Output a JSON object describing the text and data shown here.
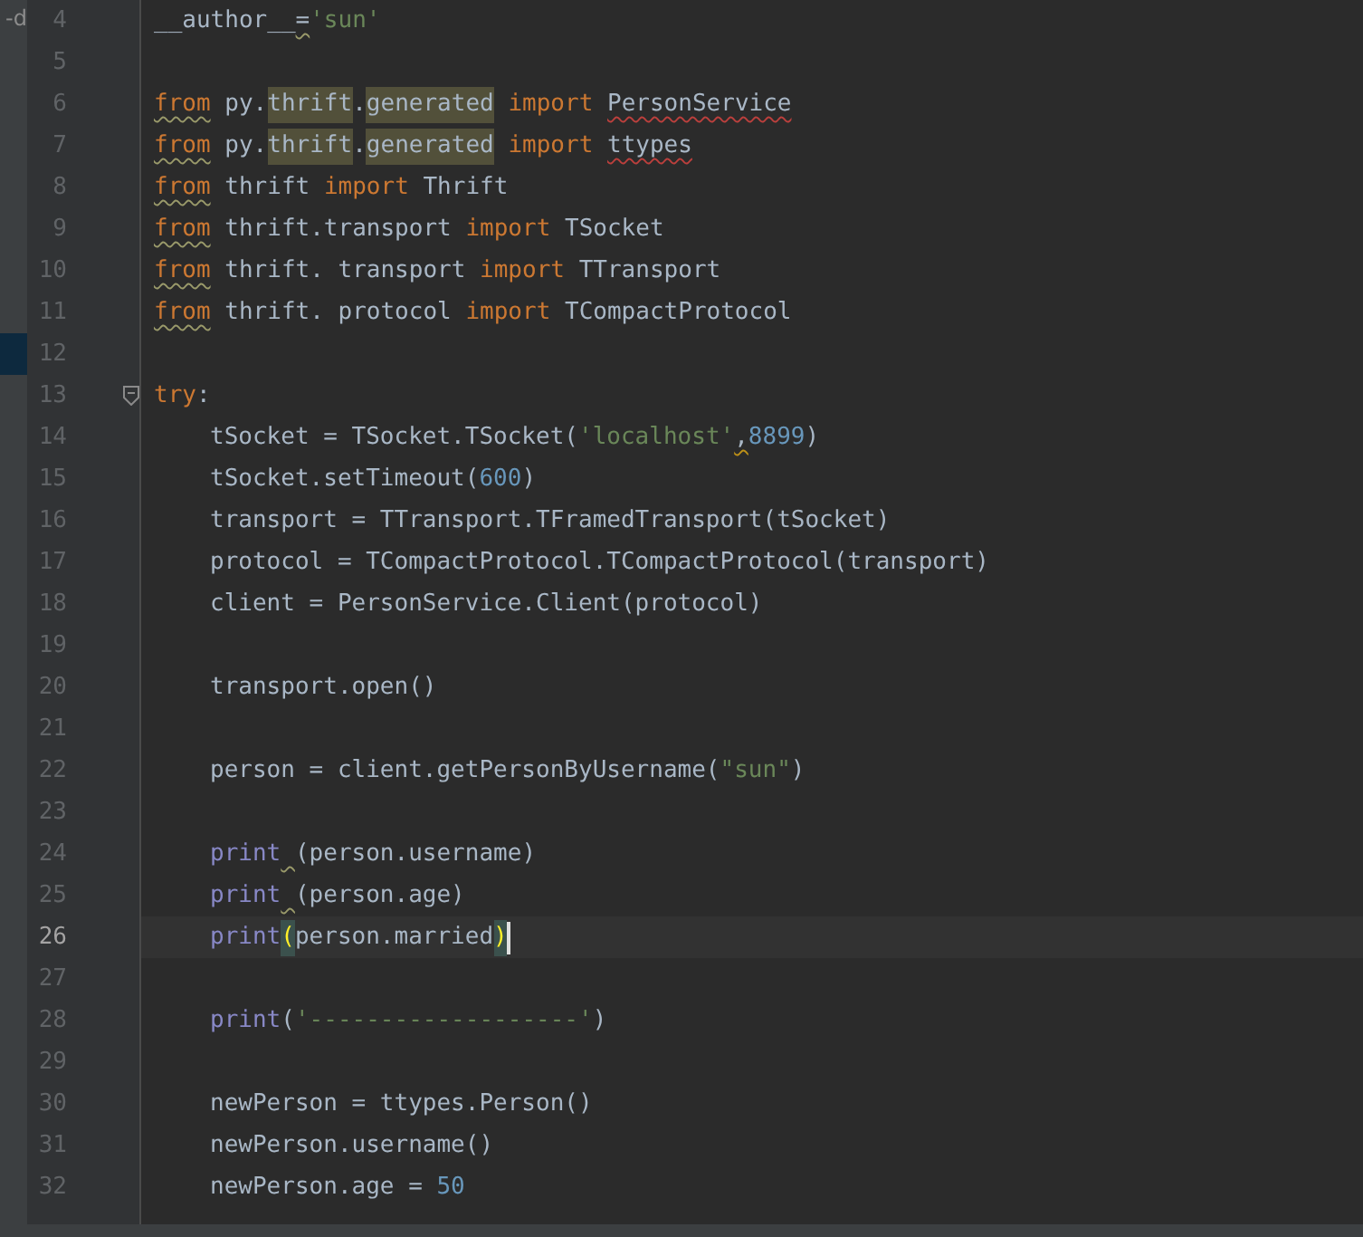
{
  "side_strip": {
    "text": "-d"
  },
  "editor": {
    "lines": [
      {
        "number": "4",
        "current": false,
        "marked": false,
        "fold": false,
        "indented": false,
        "tokens": [
          {
            "text": "__author__",
            "kind": "plain"
          },
          {
            "text": "=",
            "kind": "plain_weak"
          },
          {
            "text": "'sun'",
            "kind": "string"
          }
        ]
      },
      {
        "number": "5",
        "current": false,
        "marked": false,
        "fold": false
      },
      {
        "number": "6",
        "current": false,
        "marked": false,
        "fold": false,
        "indented": false,
        "tokens": [
          {
            "text": "from",
            "kind": "keyword_weak"
          },
          {
            "text": " py.",
            "kind": "plain"
          },
          {
            "text": "thrift",
            "kind": "usage"
          },
          {
            "text": ".",
            "kind": "plain"
          },
          {
            "text": "generated",
            "kind": "usage"
          },
          {
            "text": " import ",
            "kind": "keyword"
          },
          {
            "text": "PersonService",
            "kind": "plain_error"
          }
        ]
      },
      {
        "number": "7",
        "current": false,
        "marked": false,
        "fold": false,
        "indented": false,
        "tokens": [
          {
            "text": "from",
            "kind": "keyword_weak"
          },
          {
            "text": " py.",
            "kind": "plain"
          },
          {
            "text": "thrift",
            "kind": "usage"
          },
          {
            "text": ".",
            "kind": "plain"
          },
          {
            "text": "generated",
            "kind": "usage"
          },
          {
            "text": " import ",
            "kind": "keyword"
          },
          {
            "text": "ttypes",
            "kind": "plain_error"
          }
        ]
      },
      {
        "number": "8",
        "current": false,
        "marked": false,
        "fold": false,
        "indented": false,
        "tokens": [
          {
            "text": "from",
            "kind": "keyword_weak"
          },
          {
            "text": " thrift ",
            "kind": "plain"
          },
          {
            "text": "import",
            "kind": "keyword"
          },
          {
            "text": " Thrift",
            "kind": "plain"
          }
        ]
      },
      {
        "number": "9",
        "current": false,
        "marked": false,
        "fold": false,
        "indented": false,
        "tokens": [
          {
            "text": "from",
            "kind": "keyword_weak"
          },
          {
            "text": " thrift.transport ",
            "kind": "plain"
          },
          {
            "text": "import",
            "kind": "keyword"
          },
          {
            "text": " TSocket",
            "kind": "plain"
          }
        ]
      },
      {
        "number": "10",
        "current": false,
        "marked": false,
        "fold": false,
        "indented": false,
        "tokens": [
          {
            "text": "from",
            "kind": "keyword_weak"
          },
          {
            "text": " thrift. transport ",
            "kind": "plain"
          },
          {
            "text": "import",
            "kind": "keyword"
          },
          {
            "text": " TTransport",
            "kind": "plain"
          }
        ]
      },
      {
        "number": "11",
        "current": false,
        "marked": false,
        "fold": false,
        "indented": false,
        "tokens": [
          {
            "text": "from",
            "kind": "keyword_weak"
          },
          {
            "text": " thrift. protocol ",
            "kind": "plain"
          },
          {
            "text": "import",
            "kind": "keyword"
          },
          {
            "text": " TCompactProtocol",
            "kind": "plain"
          }
        ]
      },
      {
        "number": "12",
        "current": false,
        "marked": true,
        "fold": false
      },
      {
        "number": "13",
        "current": false,
        "marked": false,
        "fold": true,
        "indented": false,
        "tokens": [
          {
            "text": "try",
            "kind": "keyword"
          },
          {
            "text": ":",
            "kind": "plain"
          }
        ]
      },
      {
        "number": "14",
        "current": false,
        "marked": false,
        "fold": false,
        "indented": true,
        "tokens": [
          {
            "text": "tSocket = TSocket.TSocket(",
            "kind": "plain"
          },
          {
            "text": "'localhost'",
            "kind": "string"
          },
          {
            "text": ",8899",
            "kind": "number_leadwarn"
          },
          {
            "text": ")",
            "kind": "plain"
          }
        ]
      },
      {
        "number": "15",
        "current": false,
        "marked": false,
        "fold": false,
        "indented": true,
        "tokens": [
          {
            "text": "tSocket.setTimeout(",
            "kind": "plain"
          },
          {
            "text": "600",
            "kind": "number"
          },
          {
            "text": ")",
            "kind": "plain"
          }
        ]
      },
      {
        "number": "16",
        "current": false,
        "marked": false,
        "fold": false,
        "indented": true,
        "tokens": [
          {
            "text": "transport = TTransport.TFramedTransport(tSocket)",
            "kind": "plain"
          }
        ]
      },
      {
        "number": "17",
        "current": false,
        "marked": false,
        "fold": false,
        "indented": true,
        "tokens": [
          {
            "text": "protocol = TCompactProtocol.TCompactProtocol(transport)",
            "kind": "plain"
          }
        ]
      },
      {
        "number": "18",
        "current": false,
        "marked": false,
        "fold": false,
        "indented": true,
        "tokens": [
          {
            "text": "client = PersonService.Client(protocol)",
            "kind": "plain"
          }
        ]
      },
      {
        "number": "19",
        "current": false,
        "marked": false,
        "fold": false
      },
      {
        "number": "20",
        "current": false,
        "marked": false,
        "fold": false,
        "indented": true,
        "tokens": [
          {
            "text": "transport.open()",
            "kind": "plain"
          }
        ]
      },
      {
        "number": "21",
        "current": false,
        "marked": false,
        "fold": false
      },
      {
        "number": "22",
        "current": false,
        "marked": false,
        "fold": false,
        "indented": true,
        "tokens": [
          {
            "text": "person = client.getPersonByUsername(",
            "kind": "plain"
          },
          {
            "text": "\"sun\"",
            "kind": "string"
          },
          {
            "text": ")",
            "kind": "plain"
          }
        ]
      },
      {
        "number": "23",
        "current": false,
        "marked": false,
        "fold": false
      },
      {
        "number": "24",
        "current": false,
        "marked": false,
        "fold": false,
        "indented": true,
        "tokens": [
          {
            "text": "print",
            "kind": "builtin"
          },
          {
            "text": " (person.username)",
            "kind": "plain_leadweak"
          }
        ]
      },
      {
        "number": "25",
        "current": false,
        "marked": false,
        "fold": false,
        "indented": true,
        "tokens": [
          {
            "text": "print",
            "kind": "builtin"
          },
          {
            "text": " (person.age)",
            "kind": "plain_leadweak"
          }
        ]
      },
      {
        "number": "26",
        "current": true,
        "marked": false,
        "fold": false,
        "indented": true,
        "tokens": [
          {
            "text": "print",
            "kind": "builtin"
          },
          {
            "text": "(",
            "kind": "brace"
          },
          {
            "text": "person.married",
            "kind": "plain"
          },
          {
            "text": ")",
            "kind": "brace"
          }
        ]
      },
      {
        "number": "27",
        "current": false,
        "marked": false,
        "fold": false
      },
      {
        "number": "28",
        "current": false,
        "marked": false,
        "fold": false,
        "indented": true,
        "tokens": [
          {
            "text": "print",
            "kind": "builtin"
          },
          {
            "text": "(",
            "kind": "plain"
          },
          {
            "text": "'-------------------'",
            "kind": "string"
          },
          {
            "text": ")",
            "kind": "plain"
          }
        ]
      },
      {
        "number": "29",
        "current": false,
        "marked": false,
        "fold": false
      },
      {
        "number": "30",
        "current": false,
        "marked": false,
        "fold": false,
        "indented": true,
        "tokens": [
          {
            "text": "newPerson = ttypes.Person()",
            "kind": "plain"
          }
        ]
      },
      {
        "number": "31",
        "current": false,
        "marked": false,
        "fold": false,
        "indented": true,
        "tokens": [
          {
            "text": "newPerson.username()",
            "kind": "plain"
          }
        ]
      },
      {
        "number": "32",
        "current": false,
        "marked": false,
        "fold": false,
        "indented": true,
        "tokens": [
          {
            "text": "newPerson.age = ",
            "kind": "plain"
          },
          {
            "text": "50",
            "kind": "number"
          }
        ]
      }
    ]
  }
}
